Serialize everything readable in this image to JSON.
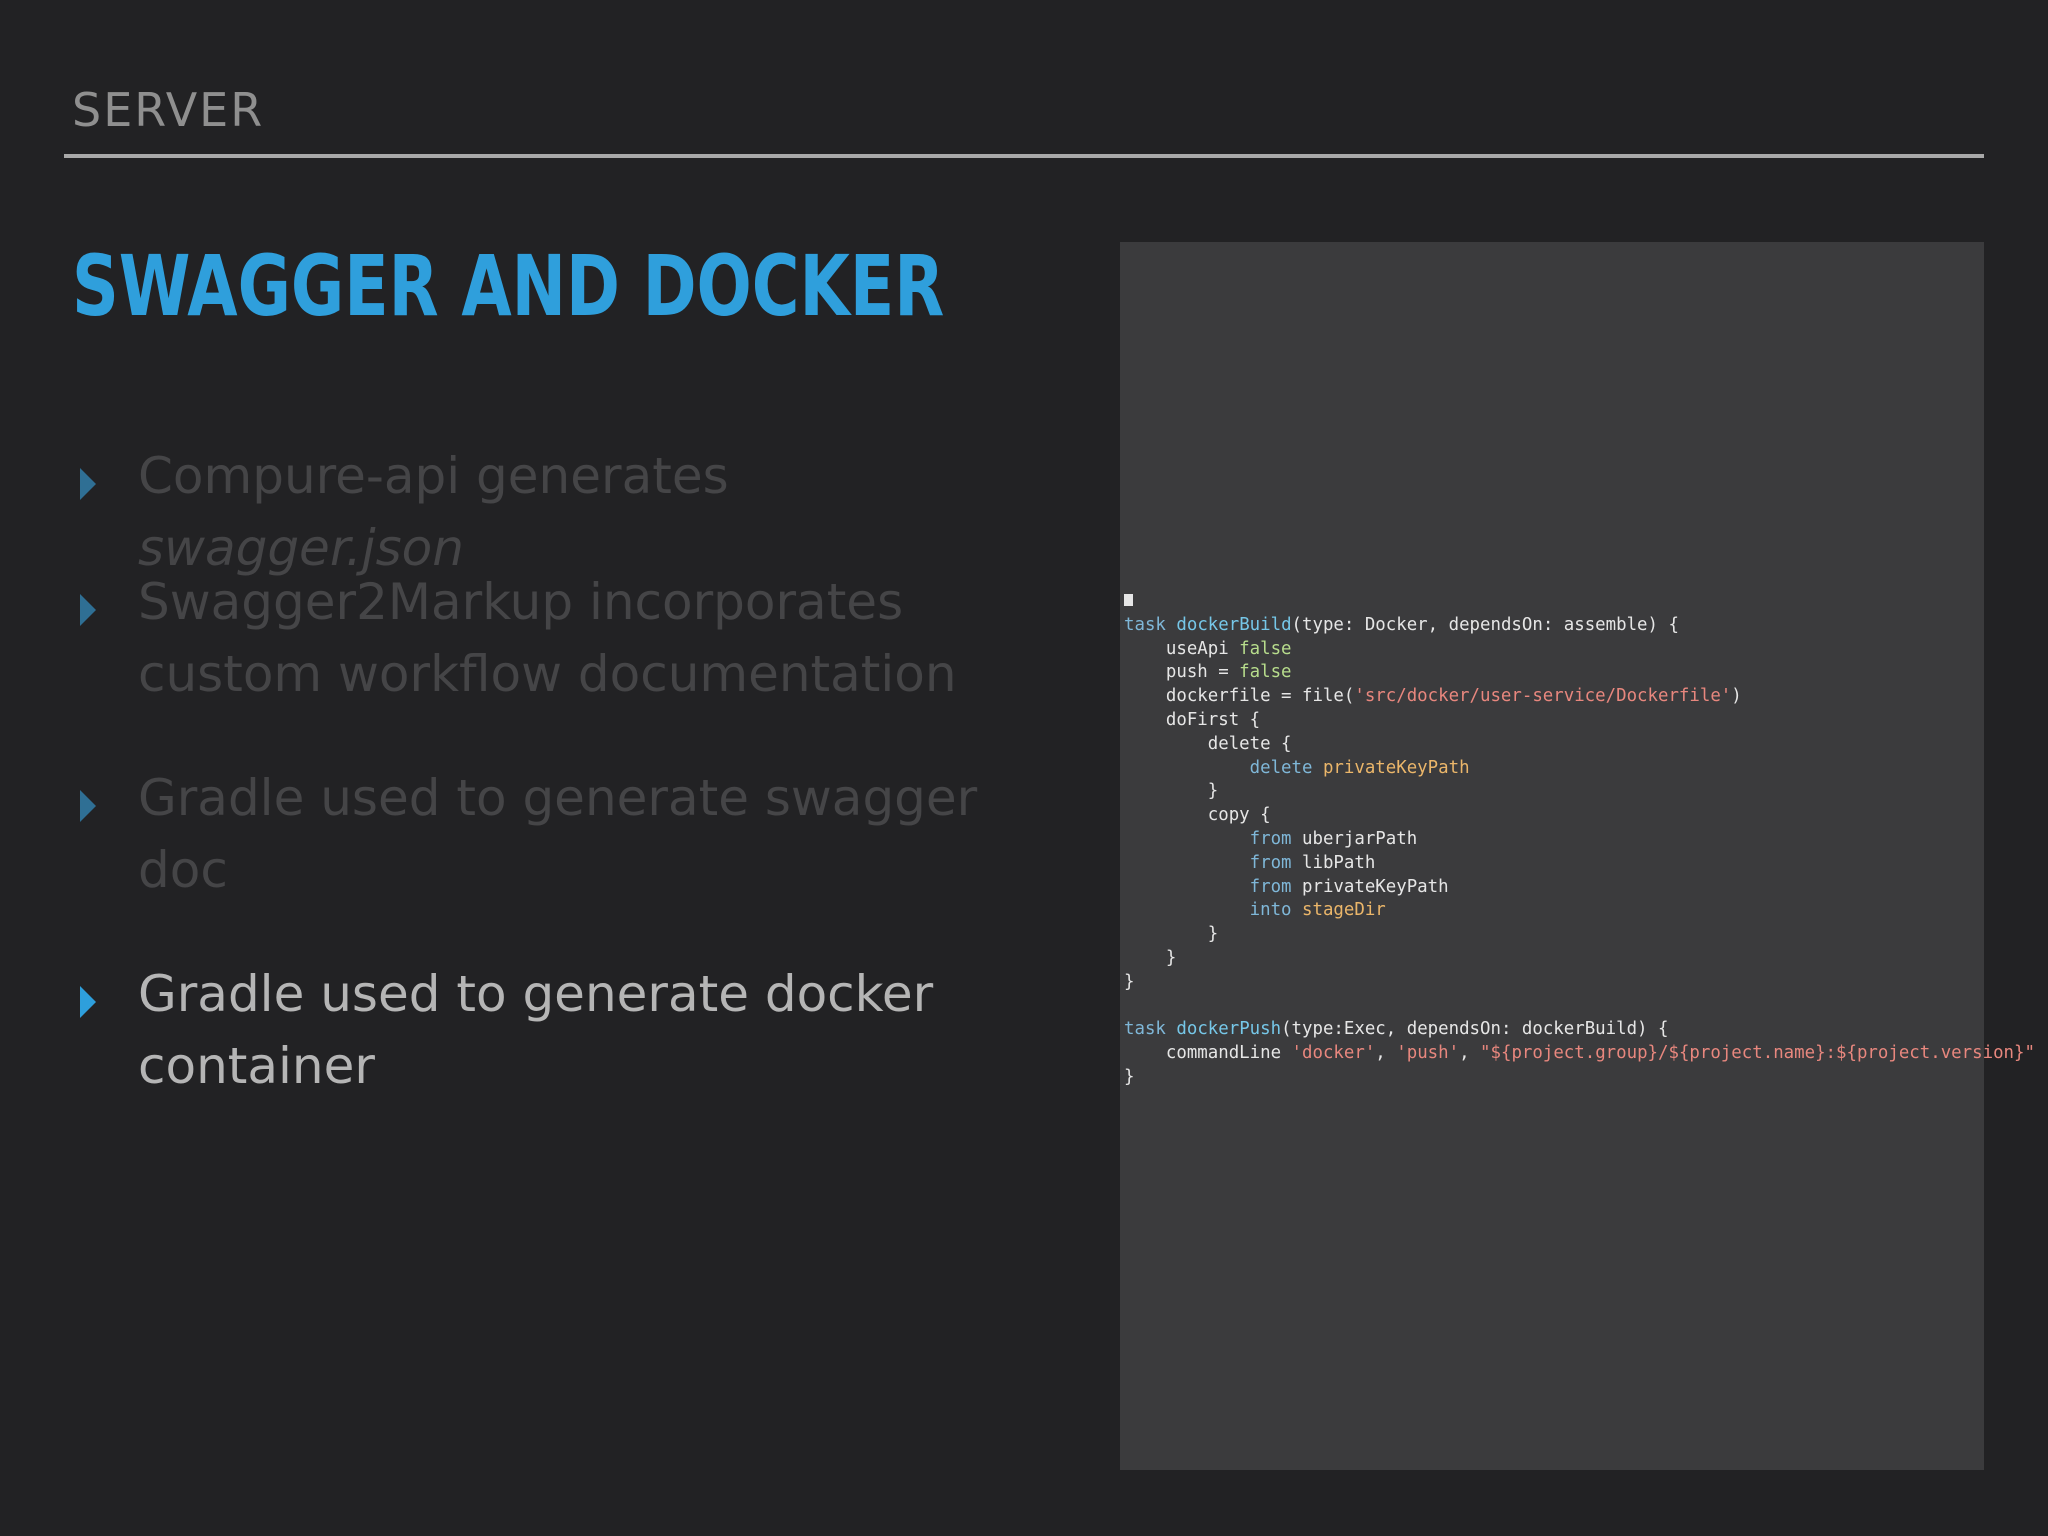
{
  "header": {
    "section": "SERVER",
    "title": "SWAGGER AND DOCKER"
  },
  "bullets": [
    {
      "text": "Compure-api generates ",
      "emphasis": "swagger.json",
      "active": false
    },
    {
      "text": "Swagger2Markup incorporates custom workflow documentation",
      "active": false
    },
    {
      "text": "Gradle used to generate swagger doc",
      "active": false
    },
    {
      "text": "Gradle used to generate docker container",
      "active": true
    }
  ],
  "code": {
    "language": "gradle",
    "lines": [
      "task dockerBuild(type: Docker, dependsOn: assemble) {",
      "    useApi false",
      "    push = false",
      "    dockerfile = file('src/docker/user-service/Dockerfile')",
      "    doFirst {",
      "        delete {",
      "            delete privateKeyPath",
      "        }",
      "        copy {",
      "            from uberjarPath",
      "            from libPath",
      "            from privateKeyPath",
      "            into stageDir",
      "        }",
      "    }",
      "}",
      "",
      "task dockerPush(type:Exec, dependsOn: dockerBuild) {",
      "    commandLine 'docker', 'push', \"${project.group}/${project.name}:${project.version}\"",
      "}"
    ]
  },
  "colors": {
    "background": "#222224",
    "title": "#2f9fdc",
    "bullet_active": "#b5b5b5",
    "bullet_inactive": "#454547",
    "code_panel": "#3b3b3d"
  }
}
